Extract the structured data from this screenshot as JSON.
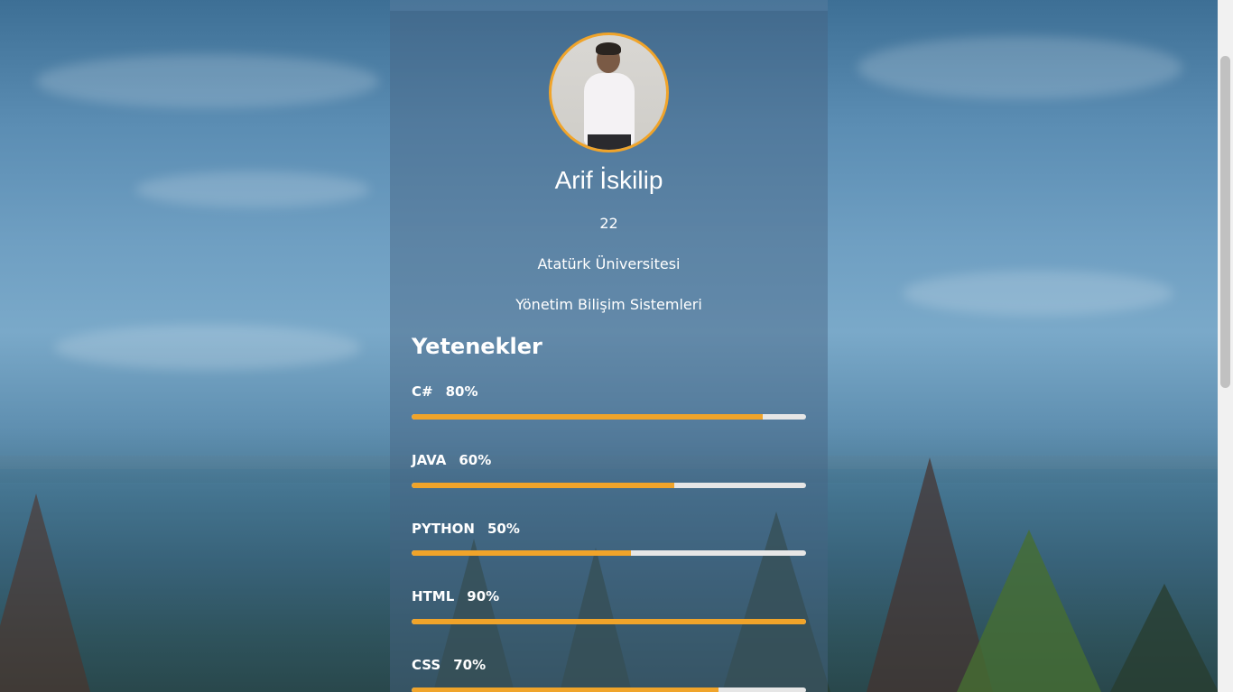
{
  "profile": {
    "name": "Arif İskilip",
    "age": "22",
    "university": "Atatürk Üniversitesi",
    "department": "Yönetim Bilişim Sistemleri"
  },
  "skills_section": {
    "title": "Yetenekler",
    "items": [
      {
        "name": "C#",
        "percent_label": "80%",
        "fill_fraction": 0.89
      },
      {
        "name": "JAVA",
        "percent_label": "60%",
        "fill_fraction": 0.667
      },
      {
        "name": "PYTHON",
        "percent_label": "50%",
        "fill_fraction": 0.556
      },
      {
        "name": "HTML",
        "percent_label": "90%",
        "fill_fraction": 1.0
      },
      {
        "name": "CSS",
        "percent_label": "70%",
        "fill_fraction": 0.778
      }
    ]
  },
  "colors": {
    "accent": "#f0a42a",
    "bar_track": "#e6e6e6",
    "text": "#ffffff"
  }
}
